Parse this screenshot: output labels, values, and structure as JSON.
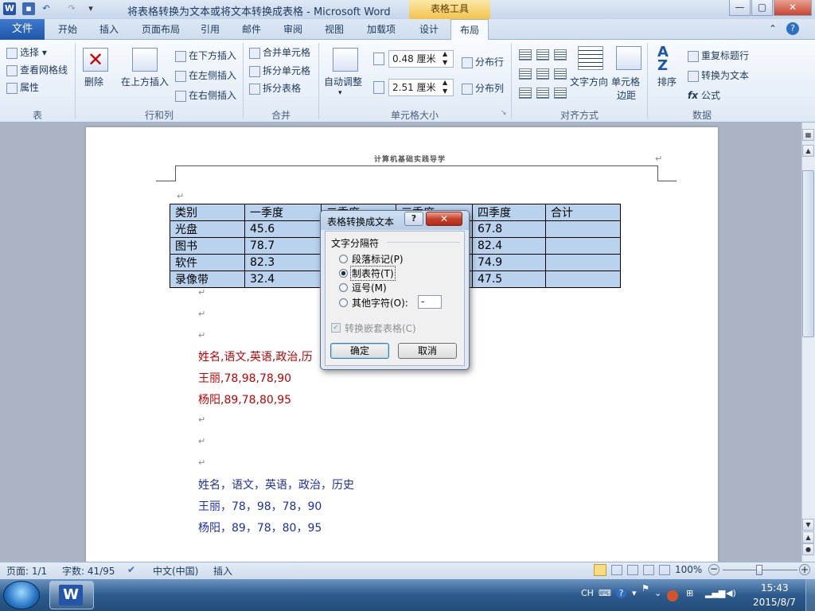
{
  "window": {
    "title": "将表格转换为文本或将文本转换成表格 - Microsoft Word",
    "table_tools": "表格工具",
    "min": "—",
    "max": "▢",
    "close": "✕"
  },
  "tabs": {
    "file": "文件",
    "items": [
      "开始",
      "插入",
      "页面布局",
      "引用",
      "邮件",
      "审阅",
      "视图",
      "加载项",
      "设计",
      "布局"
    ]
  },
  "ribbon": {
    "table_group": {
      "label": "表",
      "select": "选择",
      "gridlines": "查看网格线",
      "properties": "属性"
    },
    "rowcol_group": {
      "label": "行和列",
      "delete": "删除",
      "insert_above": "在上方插入",
      "insert_below": "在下方插入",
      "insert_left": "在左侧插入",
      "insert_right": "在右侧插入"
    },
    "merge_group": {
      "label": "合并",
      "merge": "合并单元格",
      "split": "拆分单元格",
      "split_table": "拆分表格"
    },
    "cellsize_group": {
      "label": "单元格大小",
      "autofit": "自动调整",
      "height": "0.48 厘米",
      "width": "2.51 厘米",
      "dist_rows": "分布行",
      "dist_cols": "分布列"
    },
    "align_group": {
      "label": "对齐方式",
      "text_direction": "文字方向",
      "cell_margins_1": "单元格",
      "cell_margins_2": "边距"
    },
    "data_group": {
      "label": "数据",
      "sort": "排序",
      "repeat_header": "重复标题行",
      "convert": "转换为文本",
      "formula": "公式"
    }
  },
  "document": {
    "header": "计算机基础实践导学",
    "table": {
      "headers": [
        "类别",
        "一季度",
        "二季度",
        "三季度",
        "四季度",
        "合计"
      ],
      "rows": [
        [
          "光盘",
          "45.6",
          "",
          "",
          "67.8",
          ""
        ],
        [
          "图书",
          "78.7",
          "",
          "",
          "82.4",
          ""
        ],
        [
          "软件",
          "82.3",
          "",
          "",
          "74.9",
          ""
        ],
        [
          "录像带",
          "32.4",
          "",
          "",
          "47.5",
          ""
        ]
      ]
    },
    "red_lines": [
      "姓名,语文,英语,政治,历",
      "王丽,78,98,78,90",
      "杨阳,89,78,80,95"
    ],
    "blue_lines": [
      "姓名，语文，英语，政治，历史",
      "王丽，78，98，78，90",
      "杨阳，89，78，80，95"
    ]
  },
  "dialog": {
    "title": "表格转换成文本",
    "help": "?",
    "close": "✕",
    "fieldset": "文字分隔符",
    "options": [
      "段落标记(P)",
      "制表符(T)",
      "逗号(M)",
      "其他字符(O):"
    ],
    "selected_option": "制表符(T)",
    "other_value": "-",
    "nested_checkbox": "转换嵌套表格(C)",
    "ok": "确定",
    "cancel": "取消"
  },
  "statusbar": {
    "page": "页面: 1/1",
    "words": "字数: 41/95",
    "language": "中文(中国)",
    "mode": "插入",
    "zoom": "100%"
  },
  "taskbar": {
    "lang": "CH",
    "time": "15:43",
    "date": "2015/8/7"
  },
  "colors": {
    "accent": "#1e55a8",
    "red_text": "#c00000",
    "blue_text": "#1c2fa4",
    "table_highlight": "#b9d3ee"
  }
}
